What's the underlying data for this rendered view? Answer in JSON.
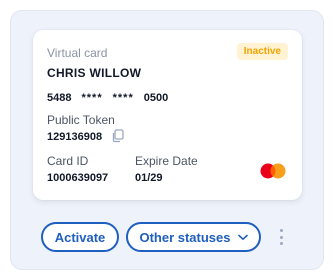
{
  "card": {
    "type_label": "Virtual card",
    "status": "Inactive",
    "holder_name": "CHRIS WILLOW",
    "number": {
      "first": "5488",
      "mask1": "****",
      "mask2": "****",
      "last": "0500"
    },
    "token_label": "Public Token",
    "token_value": "129136908",
    "id_label": "Card ID",
    "id_value": "1000639097",
    "expire_label": "Expire Date",
    "expire_value": "01/29",
    "brand_icon": "mastercard-logo"
  },
  "actions": {
    "activate_label": "Activate",
    "other_label": "Other statuses",
    "more_icon": "kebab-icon"
  },
  "colors": {
    "accent": "#1f5fbf",
    "status_text": "#f0a400",
    "status_bg": "#fff3d3",
    "panel_bg": "#eef2fa",
    "mastercard_red": "#eb001b",
    "mastercard_orange": "#f79e1b"
  }
}
